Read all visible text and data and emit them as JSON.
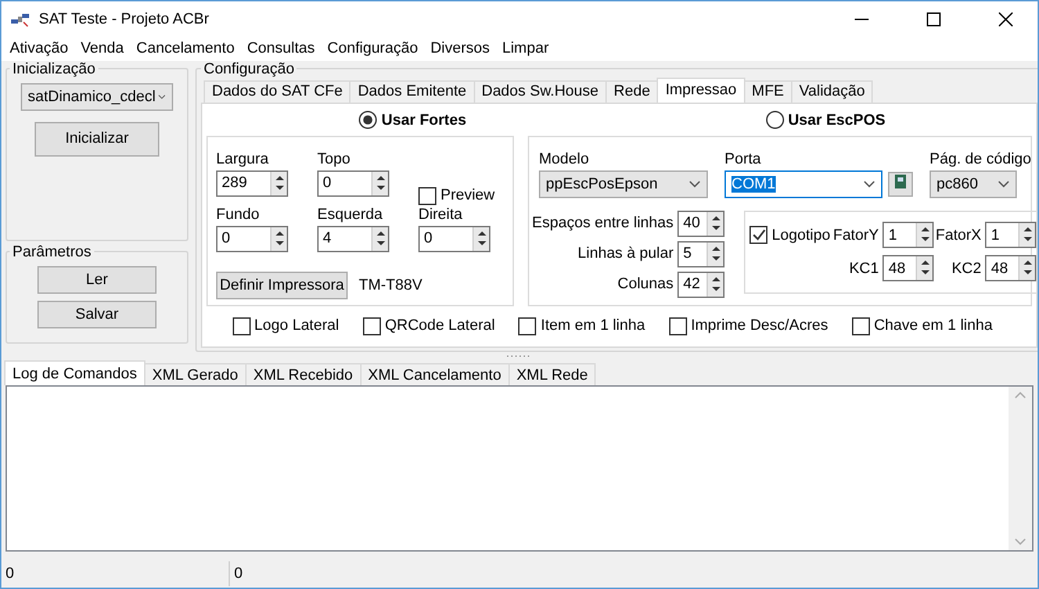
{
  "window": {
    "title": "SAT Teste - Projeto ACBr"
  },
  "menu": [
    "Ativação",
    "Venda",
    "Cancelamento",
    "Consultas",
    "Configuração",
    "Diversos",
    "Limpar"
  ],
  "inicializacao": {
    "title": "Inicialização",
    "model": "satDinamico_cdecl",
    "button": "Inicializar"
  },
  "parametros": {
    "title": "Parâmetros",
    "buttons": [
      "Ler",
      "Salvar"
    ]
  },
  "configuracao": {
    "title": "Configuração",
    "tabs": [
      {
        "label": "Dados do SAT CFe",
        "selected": false
      },
      {
        "label": "Dados Emitente",
        "selected": false
      },
      {
        "label": "Dados Sw.House",
        "selected": false
      },
      {
        "label": "Rede",
        "selected": false
      },
      {
        "label": "Impressao",
        "selected": true
      },
      {
        "label": "MFE",
        "selected": false
      },
      {
        "label": "Validação",
        "selected": false
      }
    ],
    "print_mode": [
      {
        "label": "Usar Fortes",
        "selected": true
      },
      {
        "label": "Usar EscPOS",
        "selected": false
      }
    ],
    "fortes": {
      "fields": [
        {
          "label": "Largura",
          "value": "289"
        },
        {
          "label": "Topo",
          "value": "0"
        },
        {
          "label": "Fundo",
          "value": "0"
        },
        {
          "label": "Esquerda",
          "value": "4"
        },
        {
          "label": "Direita",
          "value": "0"
        }
      ],
      "preview": {
        "label": "Preview",
        "checked": false
      },
      "button": "Definir Impressora",
      "printer": "TM-T88V"
    },
    "escpos": {
      "modelo": {
        "label": "Modelo",
        "value": "ppEscPosEpson"
      },
      "porta": {
        "label": "Porta",
        "value": "COM1",
        "highlighted": true
      },
      "pagina": {
        "label": "Pág. de código",
        "value": "pc860"
      },
      "spins": [
        {
          "label": "Espaços entre linhas",
          "value": "40"
        },
        {
          "label": "Linhas à pular",
          "value": "5"
        },
        {
          "label": "Colunas",
          "value": "42"
        }
      ],
      "logotipo": {
        "label": "Logotipo",
        "checked": true
      },
      "logo_fields": [
        {
          "label": "FatorY",
          "value": "1"
        },
        {
          "label": "FatorX",
          "value": "1"
        },
        {
          "label": "KC1",
          "value": "48"
        },
        {
          "label": "KC2",
          "value": "48"
        }
      ]
    },
    "options": [
      {
        "label": "Logo Lateral",
        "checked": false
      },
      {
        "label": "QRCode Lateral",
        "checked": false
      },
      {
        "label": "Item em 1 linha",
        "checked": false
      },
      {
        "label": "Imprime Desc/Acres",
        "checked": false
      },
      {
        "label": "Chave em 1 linha",
        "checked": false
      }
    ]
  },
  "log_tabs": [
    {
      "label": "Log de Comandos",
      "selected": true
    },
    {
      "label": "XML Gerado",
      "selected": false
    },
    {
      "label": "XML Recebido",
      "selected": false
    },
    {
      "label": "XML Cancelamento",
      "selected": false
    },
    {
      "label": "XML Rede",
      "selected": false
    }
  ],
  "status_bar": [
    "0",
    "0"
  ]
}
